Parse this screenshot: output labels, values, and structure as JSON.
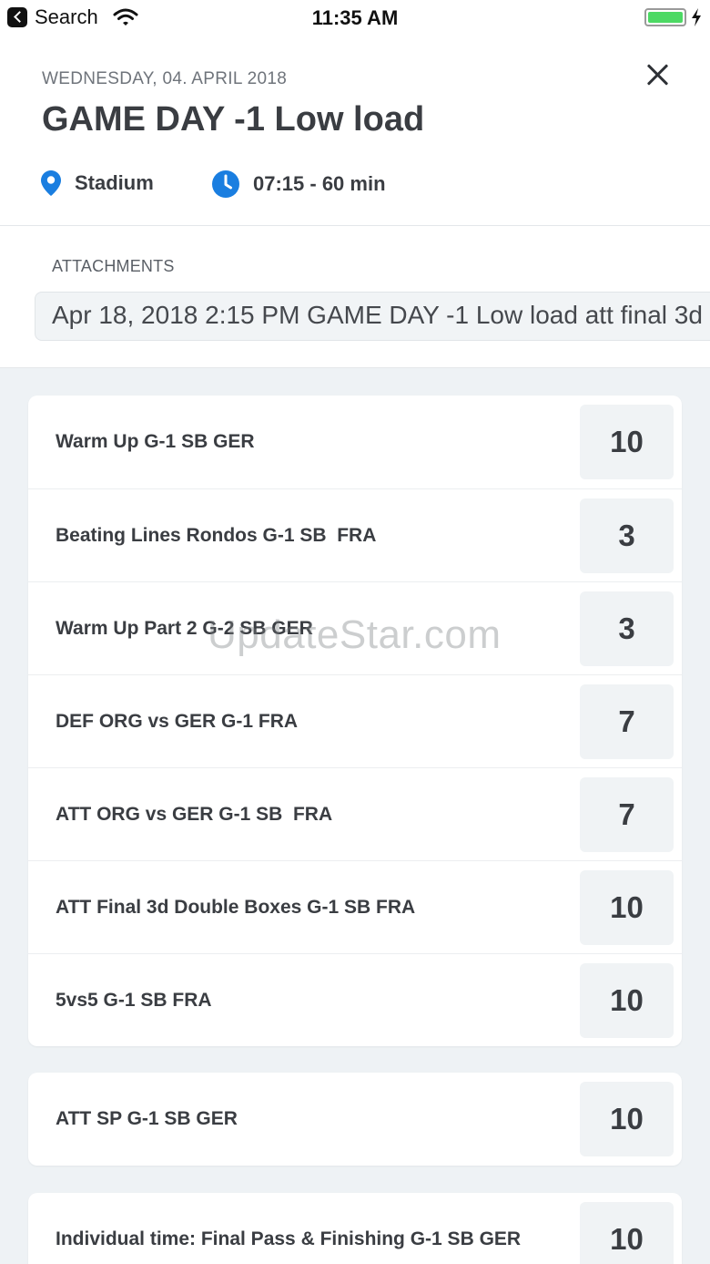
{
  "status_bar": {
    "back_label": "Search",
    "time": "11:35 AM"
  },
  "header": {
    "date": "WEDNESDAY, 04. APRIL 2018",
    "title": "GAME DAY -1 Low load",
    "location": "Stadium",
    "time_range": "07:15 - 60 min"
  },
  "attachments": {
    "label": "ATTACHMENTS",
    "items": [
      "Apr 18, 2018 2:15 PM GAME DAY -1 Low load att final 3d"
    ]
  },
  "groups": [
    {
      "rows": [
        {
          "name": "Warm Up G-1 SB GER",
          "value": "10"
        },
        {
          "name": "Beating Lines Rondos G-1 SB  FRA",
          "value": "3"
        },
        {
          "name": "Warm Up Part 2 G-2 SB GER",
          "value": "3"
        },
        {
          "name": "DEF ORG vs GER G-1 FRA",
          "value": "7"
        },
        {
          "name": "ATT ORG vs GER G-1 SB  FRA",
          "value": "7"
        },
        {
          "name": "ATT Final 3d Double Boxes G-1 SB FRA",
          "value": "10"
        },
        {
          "name": "5vs5 G-1 SB FRA",
          "value": "10"
        }
      ]
    },
    {
      "rows": [
        {
          "name": "ATT SP G-1 SB GER",
          "value": "10"
        }
      ]
    },
    {
      "rows": [
        {
          "name": "Individual time: Final Pass & Finishing G-1 SB GER",
          "value": "10"
        }
      ]
    }
  ],
  "watermark": "UpdateStar.com",
  "colors": {
    "accent": "#1a7ee0",
    "battery": "#4cd964",
    "background": "#eef2f5"
  },
  "icons": {
    "location": "location-pin-icon",
    "time": "clock-icon",
    "close": "close-icon"
  }
}
